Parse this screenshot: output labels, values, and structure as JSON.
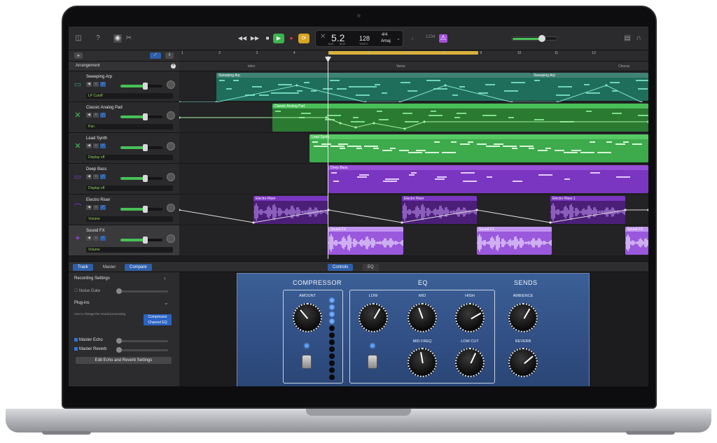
{
  "toolbar": {
    "lcd": {
      "position": "5.2",
      "tempo": "128",
      "signature": "4/4",
      "key": "Amaj",
      "bar_label": "BAR",
      "beat_label": "BEAT",
      "tempo_label": "TEMPO"
    },
    "count_in": "1234"
  },
  "header": {
    "arrangement": "Arrangement"
  },
  "ruler": {
    "bars": [
      "1",
      "2",
      "3",
      "4",
      "5",
      "6",
      "7",
      "8",
      "9",
      "10",
      "11",
      "12"
    ]
  },
  "markers": [
    "Intro",
    "Verse",
    "Chorus"
  ],
  "tracks": [
    {
      "name": "Sweeping Arp",
      "automation": "LP Cutoff",
      "color": "#2f9e83",
      "icon": "keyboard-icon"
    },
    {
      "name": "Classic Analog Pad",
      "automation": "Pan",
      "color": "#48c057",
      "icon": "synth-icon"
    },
    {
      "name": "Lead Synth",
      "automation": "Display off",
      "color": "#48c057",
      "icon": "synth-icon"
    },
    {
      "name": "Deep Bass",
      "automation": "Display off",
      "color": "#8a3fd1",
      "icon": "keyboard-icon"
    },
    {
      "name": "Electro Riser",
      "automation": "Volume",
      "color": "#8a3fd1",
      "icon": "riser-icon"
    },
    {
      "name": "Sound FX",
      "automation": "Volume",
      "color": "#8a3fd1",
      "icon": "fx-icon"
    }
  ],
  "regions": {
    "sweeping_arp": [
      "Sweeping Arp",
      "Sweeping Arp"
    ],
    "pad": [
      "Classic Analog Pad",
      "Classic Analog Pad"
    ],
    "lead": "Lead Synth",
    "bass": "Deep Bass",
    "riser": [
      "Electro Riser",
      "Electro Riser",
      "Electro Riser.1"
    ],
    "fx": [
      "Sound FX",
      "Sound FX",
      "Sound FX"
    ]
  },
  "bottom_tabs": {
    "track": "Track",
    "master": "Master",
    "compare": "Compare",
    "controls": "Controls",
    "eq": "EQ"
  },
  "smart_controls": {
    "recording_settings": "Recording Settings",
    "noise_gate": "Noise Gate",
    "plugins": "Plug-ins",
    "plugins_hint": "Use to change the sound processing.",
    "plugin_1": "Compressor",
    "plugin_2": "Channel EQ",
    "master_echo": "Master Echo",
    "master_reverb": "Master Reverb",
    "edit_button": "Edit Echo and Reverb Settings"
  },
  "panel": {
    "compressor": "COMPRESSOR",
    "eq": "EQ",
    "sends": "SENDS",
    "amount": "AMOUNT",
    "low": "LOW",
    "mid": "MID",
    "high": "HIGH",
    "mid_freq": "MID FREQ",
    "low_cut": "LOW CUT",
    "ambience": "AMBIENCE",
    "reverb": "REVERB"
  },
  "colors": {
    "accent": "#2e5fa8",
    "green": "#48c057",
    "purple": "#8a3fd1",
    "teal": "#2f9e83",
    "cycle": "#d8b13a"
  }
}
